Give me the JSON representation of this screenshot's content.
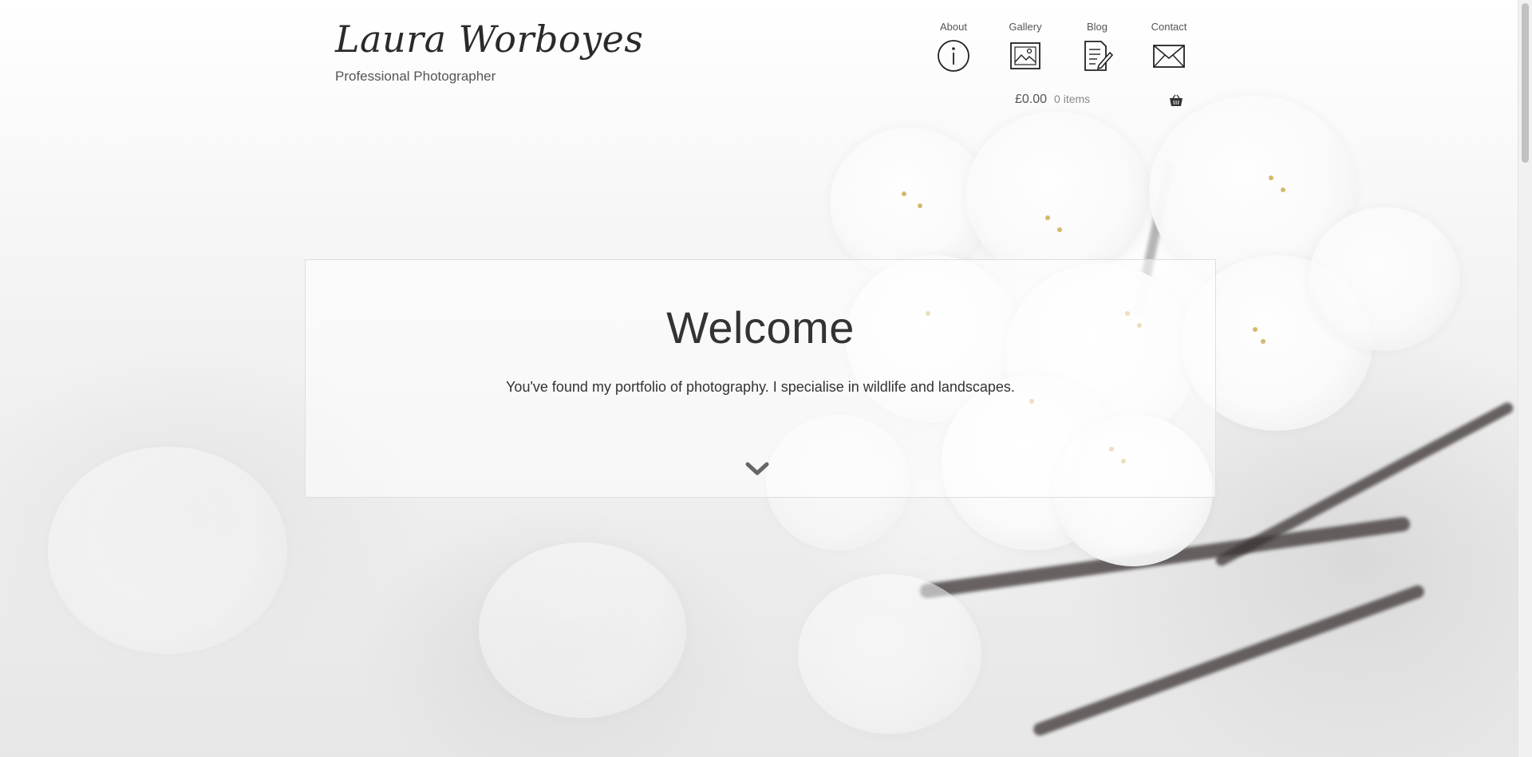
{
  "site": {
    "title": "Laura Worboyes",
    "tagline": "Professional Photographer"
  },
  "nav": {
    "items": [
      {
        "label": "About",
        "icon": "info-icon"
      },
      {
        "label": "Gallery",
        "icon": "image-icon"
      },
      {
        "label": "Blog",
        "icon": "document-edit-icon"
      },
      {
        "label": "Contact",
        "icon": "envelope-icon"
      }
    ]
  },
  "cart": {
    "total": "£0.00",
    "count": "0 items",
    "icon": "basket-icon"
  },
  "welcome": {
    "title": "Welcome",
    "text": "You've found my portfolio of photography. I specialise in wildlife and landscapes.",
    "scroll_icon": "chevron-down-icon"
  },
  "colors": {
    "text": "#333333",
    "muted": "#888888",
    "border": "#dedede"
  }
}
